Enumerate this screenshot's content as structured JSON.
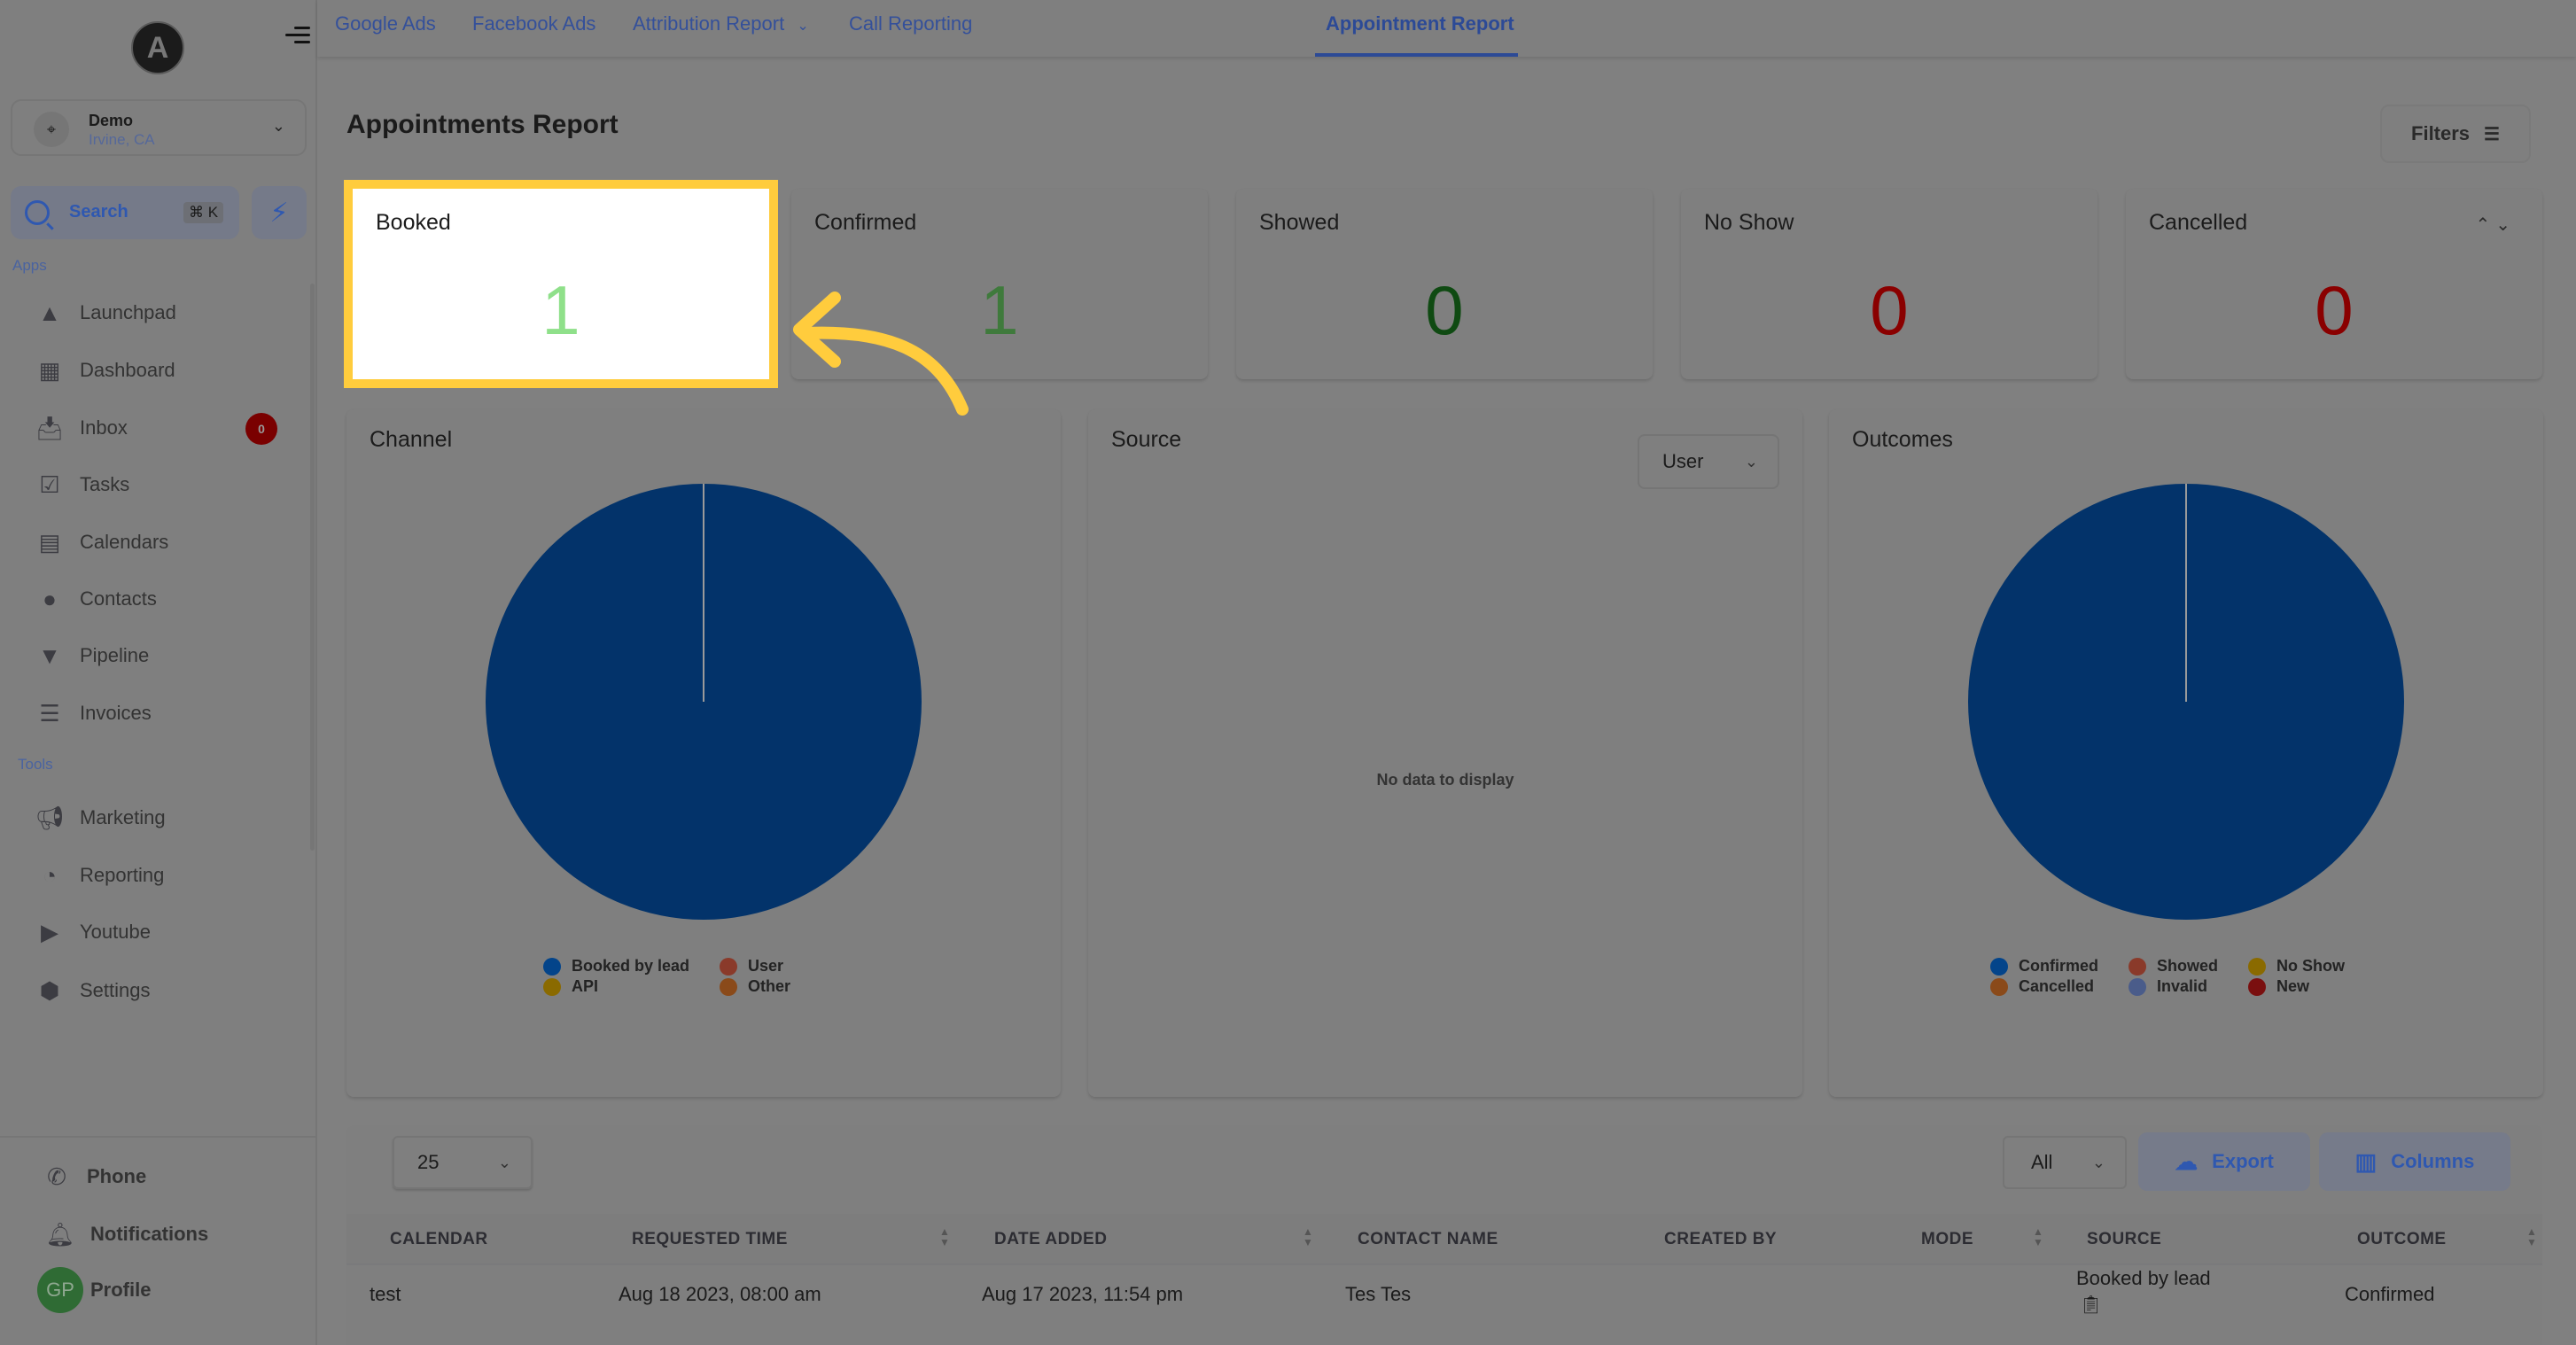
{
  "sidebar": {
    "logo_letter": "A",
    "location": {
      "name": "Demo",
      "city": "Irvine, CA"
    },
    "search": {
      "label": "Search",
      "shortcut": "⌘ K"
    },
    "apps_label": "Apps",
    "tools_label": "Tools",
    "apps": [
      {
        "label": "Launchpad",
        "icon": "rocket-icon"
      },
      {
        "label": "Dashboard",
        "icon": "grid-icon"
      },
      {
        "label": "Inbox",
        "icon": "inbox-icon",
        "badge": "0"
      },
      {
        "label": "Tasks",
        "icon": "clipboard-check-icon"
      },
      {
        "label": "Calendars",
        "icon": "calendar-icon"
      },
      {
        "label": "Contacts",
        "icon": "person-icon"
      },
      {
        "label": "Pipeline",
        "icon": "funnel-icon"
      },
      {
        "label": "Invoices",
        "icon": "receipt-icon"
      }
    ],
    "tools": [
      {
        "label": "Marketing",
        "icon": "megaphone-icon"
      },
      {
        "label": "Reporting",
        "icon": "pie-icon"
      },
      {
        "label": "Youtube",
        "icon": "play-icon"
      },
      {
        "label": "Settings",
        "icon": "gear-icon"
      }
    ],
    "bottom": {
      "phone": "Phone",
      "notifications": "Notifications",
      "profile": "Profile",
      "profile_initials": "GP"
    }
  },
  "topnav": {
    "tabs": [
      {
        "label": "Google Ads"
      },
      {
        "label": "Facebook Ads"
      },
      {
        "label": "Attribution Report",
        "has_dropdown": true
      },
      {
        "label": "Call Reporting"
      },
      {
        "label": "Appointment Report",
        "active": true
      }
    ]
  },
  "page": {
    "title": "Appointments Report",
    "filters_label": "Filters"
  },
  "stats": [
    {
      "label": "Booked",
      "value": "1",
      "color": "#8fe08a",
      "highlighted": true
    },
    {
      "label": "Confirmed",
      "value": "1",
      "color": "#3f7a3c"
    },
    {
      "label": "Showed",
      "value": "0",
      "color": "#0f4a12"
    },
    {
      "label": "No Show",
      "value": "0",
      "color": "#8a0000"
    },
    {
      "label": "Cancelled",
      "value": "0",
      "color": "#8a0000"
    }
  ],
  "source_select": {
    "value": "User"
  },
  "no_data_text": "No data to display",
  "chart_data": [
    {
      "type": "pie",
      "title": "Channel",
      "labels": [
        "Booked by lead",
        "User",
        "API",
        "Other"
      ],
      "values": [
        1,
        0,
        0,
        0
      ],
      "colors": [
        "#03336a",
        "#8a3a2a",
        "#8a6a00",
        "#8a4a1a"
      ],
      "legend_dot_colors": [
        "#03448a",
        "#8a3a2a",
        "#8a6a00",
        "#8a4a1a"
      ],
      "legend": "bottom"
    },
    {
      "type": "pie",
      "title": "Source",
      "labels": [],
      "values": [],
      "legend": "none"
    },
    {
      "type": "pie",
      "title": "Outcomes",
      "labels": [
        "Confirmed",
        "Showed",
        "No Show",
        "Cancelled",
        "Invalid",
        "New"
      ],
      "values": [
        1,
        0,
        0,
        0,
        0,
        0
      ],
      "colors": [
        "#03336a",
        "#8a3a2a",
        "#8a6a00",
        "#8a4a1a",
        "#4a5c8a",
        "#7a0f0f"
      ],
      "legend_dot_colors": [
        "#03448a",
        "#8a3a2a",
        "#8a6a00",
        "#8a4a1a",
        "#4a5c8a",
        "#7a0f0f"
      ],
      "legend": "bottom"
    }
  ],
  "table": {
    "page_size": "25",
    "filter": "All",
    "export_label": "Export",
    "columns_label": "Columns",
    "headers": [
      "CALENDAR",
      "REQUESTED TIME",
      "DATE ADDED",
      "CONTACT NAME",
      "CREATED BY",
      "MODE",
      "SOURCE",
      "OUTCOME"
    ],
    "rows": [
      {
        "calendar": "test",
        "requested_time": "Aug 18 2023, 08:00 am",
        "date_added": "Aug 17 2023, 11:54 pm",
        "contact_name": "Tes Tes",
        "created_by": "",
        "mode": "",
        "source": "Booked by lead",
        "outcome": "Confirmed"
      }
    ]
  },
  "annotation": {
    "color": "#ffcc3d"
  }
}
